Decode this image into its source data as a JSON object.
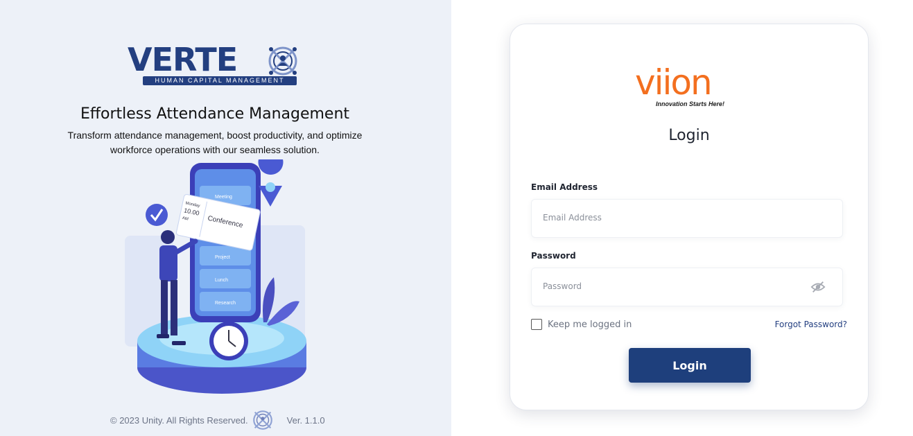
{
  "left_panel": {
    "brand": {
      "name": "VERTE",
      "tagline": "HUMAN CAPITAL MANAGEMENT"
    },
    "headline": "Effortless Attendance Management",
    "subline": "Transform attendance management, boost productivity, and optimize workforce operations with our seamless solution.",
    "illustration": {
      "calendar_card": {
        "day": "Monday",
        "time": "10.00",
        "period": "AM",
        "event": "Conference"
      },
      "schedule_items": [
        "Meeting",
        "Project",
        "Lunch",
        "Research"
      ]
    },
    "footer": {
      "copyright": "© 2023 Unity. All Rights Reserved.",
      "version": "Ver. 1.1.0"
    }
  },
  "login_card": {
    "logo": {
      "name": "viion",
      "tagline": "Innovation Starts Here!"
    },
    "title": "Login",
    "email": {
      "label": "Email Address",
      "placeholder": "Email Address",
      "value": ""
    },
    "password": {
      "label": "Password",
      "placeholder": "Password",
      "value": "",
      "toggle_icon": "eye-off-icon"
    },
    "remember_label": "Keep me logged in",
    "remember_checked": false,
    "forgot_link": "Forgot Password?",
    "submit_label": "Login"
  },
  "colors": {
    "left_bg": "#edf1f8",
    "brand_blue": "#233f80",
    "button_blue": "#1e3f7c",
    "viion_orange": "#f36f1f"
  }
}
